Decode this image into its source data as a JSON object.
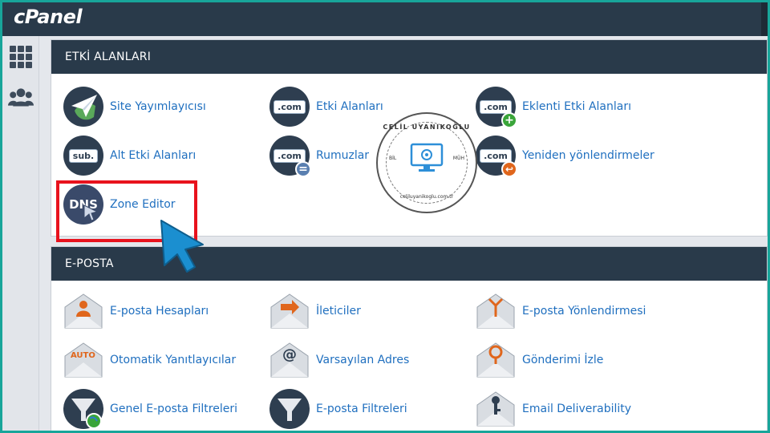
{
  "app": {
    "logo": "cPanel"
  },
  "sidebar": {
    "items": [
      {
        "name": "apps-grid-icon"
      },
      {
        "name": "users-icon"
      }
    ]
  },
  "sections": {
    "domains": {
      "title": "ETKİ ALANLARI",
      "items": [
        {
          "label": "Site Yayımlayıcısı",
          "icon": "site-publisher-icon"
        },
        {
          "label": "Etki Alanları",
          "icon": "domains-icon",
          "badge": ".com"
        },
        {
          "label": "Eklenti Etki Alanları",
          "icon": "addon-domains-icon",
          "badge": ".com",
          "mini": "+"
        },
        {
          "label": "Alt Etki Alanları",
          "icon": "subdomains-icon",
          "badge": "sub."
        },
        {
          "label": "Rumuzlar",
          "icon": "aliases-icon",
          "badge": ".com",
          "mini": "="
        },
        {
          "label": "Yeniden yönlendirmeler",
          "icon": "redirects-icon",
          "badge": ".com",
          "mini": "↩"
        },
        {
          "label": "Zone Editor",
          "icon": "dns-icon",
          "badge": "DNS"
        }
      ]
    },
    "email": {
      "title": "E-POSTA",
      "items": [
        {
          "label": "E-posta Hesapları",
          "icon": "email-accounts-icon"
        },
        {
          "label": "İleticiler",
          "icon": "forwarders-icon"
        },
        {
          "label": "E-posta Yönlendirmesi",
          "icon": "email-routing-icon"
        },
        {
          "label": "Otomatik Yanıtlayıcılar",
          "icon": "autoresponders-icon",
          "badge": "AUTO"
        },
        {
          "label": "Varsayılan Adres",
          "icon": "default-address-icon",
          "badge": "@"
        },
        {
          "label": "Gönderimi İzle",
          "icon": "track-delivery-icon"
        },
        {
          "label": "Genel E-posta Filtreleri",
          "icon": "global-email-filters-icon"
        },
        {
          "label": "E-posta Filtreleri",
          "icon": "email-filters-icon"
        },
        {
          "label": "Email Deliverability",
          "icon": "email-deliverability-icon"
        }
      ]
    }
  },
  "watermark": {
    "top": "CELİL UYANIKOĞLU",
    "left": "BİL",
    "right": "MÜH",
    "bottom": "celiluyanikoglu.com.tr"
  },
  "colors": {
    "accent": "#1f6fbf",
    "header": "#293a4a",
    "highlight": "#e8121d",
    "cursor": "#1b8fd0",
    "frame": "#18a59a"
  }
}
